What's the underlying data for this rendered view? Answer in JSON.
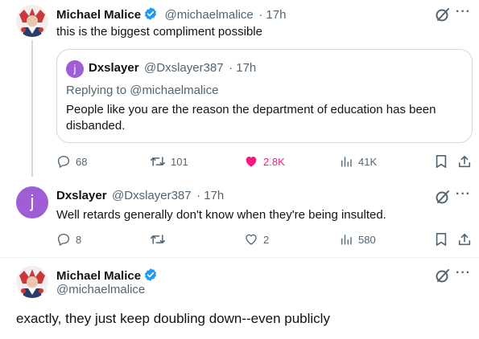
{
  "tweet1": {
    "name": "Michael Malice",
    "handle": "@michaelmalice",
    "time": "· 17h",
    "text": "this is the biggest compliment possible",
    "quote": {
      "avatar_letter": "j",
      "name": "Dxslayer",
      "handle": "@Dxslayer387",
      "time": "· 17h",
      "replying_to": "Replying to @michaelmalice",
      "text": "People like you are the reason the department of education has been disbanded."
    },
    "actions": {
      "replies": "68",
      "retweets": "101",
      "likes": "2.8K",
      "views": "41K"
    }
  },
  "tweet2": {
    "avatar_letter": "j",
    "name": "Dxslayer",
    "handle": "@Dxslayer387",
    "time": "· 17h",
    "text": "Well retards generally don't know when they're being insulted.",
    "actions": {
      "replies": "8",
      "retweets": "",
      "likes": "2",
      "views": "580"
    }
  },
  "tweet3": {
    "name": "Michael Malice",
    "handle": "@michaelmalice",
    "text": "exactly, they just keep doubling down--even publicly"
  },
  "colors": {
    "accent": "#1d9bf0",
    "like": "#f91880",
    "muted": "#536471",
    "quote_avatar": "#a05ed6"
  },
  "icons": [
    "grok-icon",
    "more-icon",
    "verified-icon",
    "reply-icon",
    "retweet-icon",
    "like-icon",
    "views-icon",
    "bookmark-icon",
    "share-icon"
  ]
}
